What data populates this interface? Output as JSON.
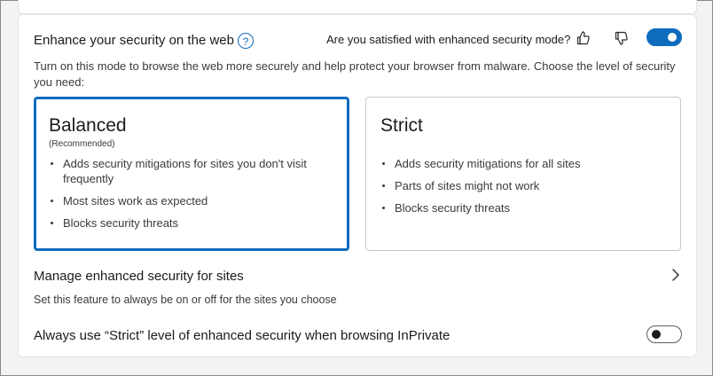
{
  "enhance": {
    "title": "Enhance your security on the web",
    "help_icon": "?",
    "satisfied_prompt": "Are you satisfied with enhanced security mode?",
    "toggle_on": true,
    "description": "Turn on this mode to browse the web more securely and help protect your browser from malware. Choose the level of security you need:"
  },
  "modes": [
    {
      "title": "Balanced",
      "subtitle": "(Recommended)",
      "selected": true,
      "bullets": [
        "Adds security mitigations for sites you don't visit frequently",
        "Most sites work as expected",
        "Blocks security threats"
      ]
    },
    {
      "title": "Strict",
      "subtitle": "",
      "selected": false,
      "bullets": [
        "Adds security mitigations for all sites",
        "Parts of sites might not work",
        "Blocks security threats"
      ]
    }
  ],
  "manage": {
    "title": "Manage enhanced security for sites",
    "subtitle": "Set this feature to always be on or off for the sites you choose"
  },
  "inprivate": {
    "title": "Always use “Strict” level of enhanced security when browsing InPrivate",
    "toggle_on": false
  },
  "colors": {
    "accent": "#0f6cbd",
    "card_bg": "#ffffff",
    "page_bg": "#f3f3f3"
  }
}
